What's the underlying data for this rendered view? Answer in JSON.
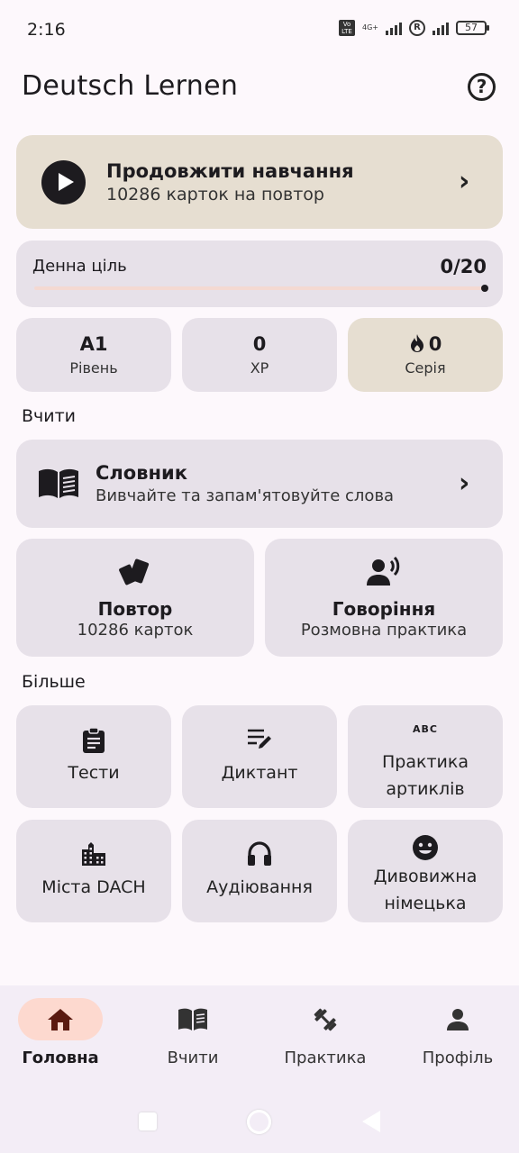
{
  "status": {
    "time": "2:16",
    "network": "4G+",
    "volte": "Vo LTE",
    "battery": "57"
  },
  "header": {
    "title": "Deutsch Lernen",
    "help": "?"
  },
  "continue": {
    "title": "Продовжити навчання",
    "subtitle": "10286 карток на повтор"
  },
  "goal": {
    "label": "Денна ціль",
    "value": "0/20",
    "progress": 0
  },
  "stats": [
    {
      "value": "A1",
      "label": "Рівень"
    },
    {
      "value": "0",
      "label": "XP"
    },
    {
      "value": "0",
      "label": "Серія"
    }
  ],
  "learn": {
    "heading": "Вчити",
    "dictionary": {
      "title": "Словник",
      "subtitle": "Вивчайте та запам'ятовуйте слова"
    },
    "review": {
      "title": "Повтор",
      "subtitle": "10286 карток"
    },
    "speaking": {
      "title": "Говоріння",
      "subtitle": "Розмовна практика"
    }
  },
  "more": {
    "heading": "Більше",
    "tiles": [
      {
        "label": "Тести"
      },
      {
        "label": "Диктант"
      },
      {
        "line1": "Практика",
        "line2": "артиклів"
      },
      {
        "label": "Міста DACH"
      },
      {
        "label": "Аудіювання"
      },
      {
        "line1": "Дивовижна",
        "line2": "німецька"
      }
    ]
  },
  "nav": [
    {
      "label": "Головна",
      "active": true
    },
    {
      "label": "Вчити"
    },
    {
      "label": "Практика"
    },
    {
      "label": "Профіль"
    }
  ],
  "colors": {
    "background": "#fdf8fc",
    "card": "#e7e1e9",
    "accent_card": "#e6ded1",
    "nav_active": "#fdd9cf"
  }
}
